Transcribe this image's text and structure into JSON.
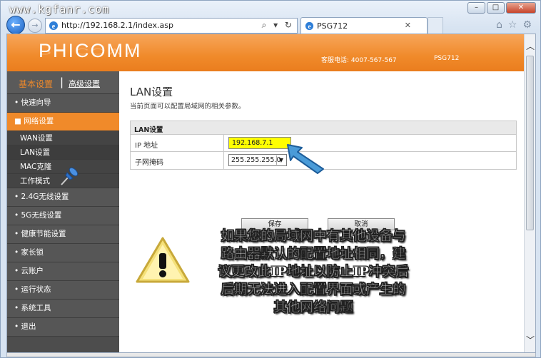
{
  "watermark": "www.kgfanr.com",
  "window": {
    "minimize": "–",
    "maximize": "□",
    "close": "✕"
  },
  "browser": {
    "url": "http://192.168.2.1/index.asp",
    "url_tools": "⌕ ▾ ↻",
    "tab_title": "PSG712",
    "tab_close": "✕",
    "icons": [
      "home-icon",
      "star-icon",
      "gear-icon"
    ]
  },
  "header": {
    "logo": "PHICOMM",
    "hotline": "客服电话: 4007-567-567",
    "model": "PSG712"
  },
  "sidebar": {
    "basic": "基本设置",
    "separator": "|",
    "advanced": "高级设置",
    "items": [
      {
        "label": "• 快速向导",
        "active": false
      },
      {
        "label": "■ 网络设置",
        "active": true,
        "sub": [
          "WAN设置",
          "LAN设置",
          "MAC克隆",
          "工作模式"
        ]
      },
      {
        "label": "• 2.4G无线设置",
        "active": false
      },
      {
        "label": "• 5G无线设置",
        "active": false
      },
      {
        "label": "• 健康节能设置",
        "active": false
      },
      {
        "label": "• 家长锁",
        "active": false
      },
      {
        "label": "• 云账户",
        "active": false
      },
      {
        "label": "• 运行状态",
        "active": false
      },
      {
        "label": "• 系统工具",
        "active": false
      },
      {
        "label": "• 退出",
        "active": false
      }
    ]
  },
  "main": {
    "title": "LAN设置",
    "description": "当前页面可以配置局域网的相关参数。",
    "table_header": "LAN设置",
    "ip_label": "IP 地址",
    "ip_value": "192.168.7.1",
    "mask_label": "子网掩码",
    "mask_value": "255.255.255.0",
    "save": "保存",
    "cancel": "取消"
  },
  "notice": {
    "line1": "如果您的局域网中有其他设备与",
    "line2": "路由器默认的配置地址相同，建",
    "line3": "议更改此IP地址以防止IP冲突后",
    "line4": "后期无法进入配置界面或产生的",
    "line5": "其他网络问题"
  },
  "colors": {
    "accent": "#f08a2a",
    "sidebar": "#4d4d4d",
    "highlight": "#ffff00"
  }
}
